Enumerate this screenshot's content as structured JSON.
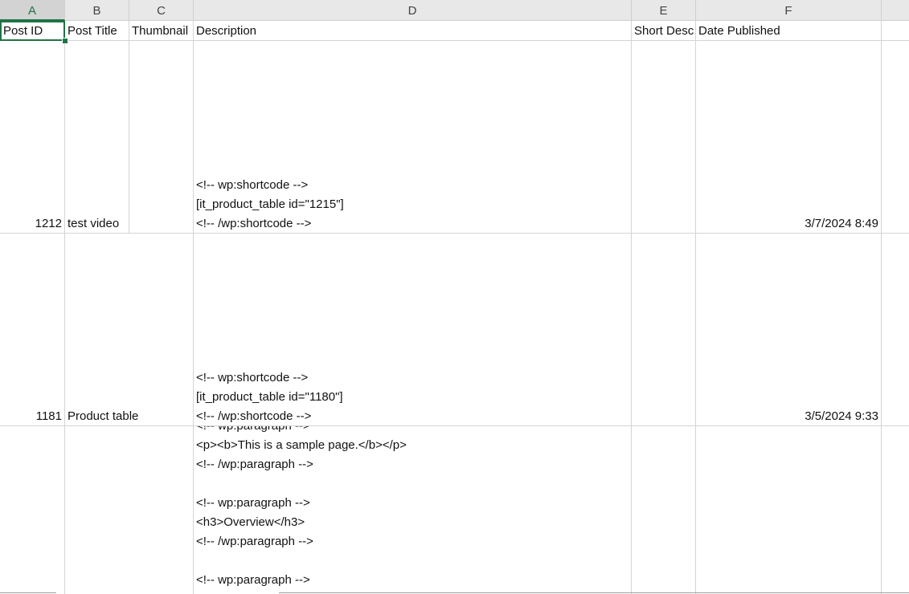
{
  "columns": [
    "A",
    "B",
    "C",
    "D",
    "E",
    "F"
  ],
  "headers": {
    "post_id": "Post ID",
    "post_title": "Post Title",
    "thumbnail": "Thumbnail",
    "description": "Description",
    "short_desc": "Short Desc",
    "date_published": "Date Published"
  },
  "rows": [
    {
      "post_id": "1212",
      "post_title": "test video",
      "description_lines": [
        "<!-- wp:shortcode -->",
        "[it_product_table id=\"1215\"]",
        "<!-- /wp:shortcode -->"
      ],
      "date_published": "3/7/2024 8:49"
    },
    {
      "post_id": "1181",
      "post_title": "Product table",
      "description_lines": [
        "<!-- wp:shortcode -->",
        "[it_product_table id=\"1180\"]",
        "<!-- /wp:shortcode -->"
      ],
      "date_published": "3/5/2024 9:33"
    },
    {
      "description_lines": [
        "<!-- wp:paragraph -->",
        "<p><b>This is a sample page.</b></p>",
        "<!-- /wp:paragraph -->",
        "",
        "<!-- wp:paragraph -->",
        "<h3>Overview</h3>",
        "<!-- /wp:paragraph -->",
        "",
        "<!-- wp:paragraph -->"
      ]
    }
  ]
}
